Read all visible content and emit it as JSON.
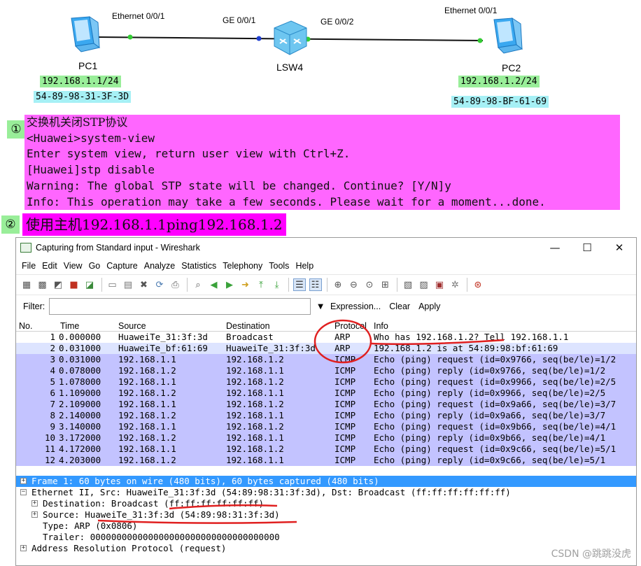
{
  "topology": {
    "pc1": {
      "name": "PC1",
      "port": "Ethernet 0/0/1",
      "ip": "192.168.1.1/24",
      "mac": "54-89-98-31-3F-3D"
    },
    "switch": {
      "name": "LSW4",
      "port_left": "GE 0/0/1",
      "port_right": "GE 0/0/2"
    },
    "pc2": {
      "name": "PC2",
      "port": "Ethernet 0/0/1",
      "ip": "192.168.1.2/24",
      "mac": "54-89-98-BF-61-69"
    }
  },
  "step1": {
    "number": "①",
    "lines": [
      "交换机关闭STP协议",
      "<Huawei>system-view",
      "Enter system view, return user view with Ctrl+Z.",
      "[Huawei]stp disable",
      "Warning: The global STP state will be changed. Continue? [Y/N]y",
      "Info: This operation may take a few seconds. Please wait for a moment...done."
    ]
  },
  "step2": {
    "number": "②",
    "text": "使用主机192.168.1.1ping192.168.1.2"
  },
  "wireshark": {
    "title": "Capturing from Standard input - Wireshark",
    "window_controls": [
      "—",
      "☐",
      "✕"
    ],
    "menu": [
      "File",
      "Edit",
      "View",
      "Go",
      "Capture",
      "Analyze",
      "Statistics",
      "Telephony",
      "Tools",
      "Help"
    ],
    "filter": {
      "label": "Filter:",
      "value": "",
      "expression": "Expression...",
      "clear": "Clear",
      "apply": "Apply"
    },
    "columns": {
      "no": "No.",
      "time": "Time",
      "source": "Source",
      "destination": "Destination",
      "protocol": "Protocol",
      "info": "Info"
    },
    "packets": [
      {
        "no": "1",
        "time": "0.000000",
        "source": "HuaweiTe_31:3f:3d",
        "destination": "Broadcast",
        "protocol": "ARP",
        "info": "Who has 192.168.1.2?  Tell 192.168.1.1",
        "bg": "#ffffff"
      },
      {
        "no": "2",
        "time": "0.031000",
        "source": "HuaweiTe_bf:61:69",
        "destination": "HuaweiTe_31:3f:3d",
        "protocol": "ARP",
        "info": "192.168.1.2 is at 54:89:98:bf:61:69",
        "bg": "#dde4ff"
      },
      {
        "no": "3",
        "time": "0.031000",
        "source": "192.168.1.1",
        "destination": "192.168.1.2",
        "protocol": "ICMP",
        "info": "Echo (ping) request  (id=0x9766, seq(be/le)=1/2",
        "bg": "#c3c3ff"
      },
      {
        "no": "4",
        "time": "0.078000",
        "source": "192.168.1.2",
        "destination": "192.168.1.1",
        "protocol": "ICMP",
        "info": "Echo (ping) reply    (id=0x9766, seq(be/le)=1/2",
        "bg": "#c3c3ff"
      },
      {
        "no": "5",
        "time": "1.078000",
        "source": "192.168.1.1",
        "destination": "192.168.1.2",
        "protocol": "ICMP",
        "info": "Echo (ping) request  (id=0x9966, seq(be/le)=2/5",
        "bg": "#c3c3ff"
      },
      {
        "no": "6",
        "time": "1.109000",
        "source": "192.168.1.2",
        "destination": "192.168.1.1",
        "protocol": "ICMP",
        "info": "Echo (ping) reply    (id=0x9966, seq(be/le)=2/5",
        "bg": "#c3c3ff"
      },
      {
        "no": "7",
        "time": "2.109000",
        "source": "192.168.1.1",
        "destination": "192.168.1.2",
        "protocol": "ICMP",
        "info": "Echo (ping) request  (id=0x9a66, seq(be/le)=3/7",
        "bg": "#c3c3ff"
      },
      {
        "no": "8",
        "time": "2.140000",
        "source": "192.168.1.2",
        "destination": "192.168.1.1",
        "protocol": "ICMP",
        "info": "Echo (ping) reply    (id=0x9a66, seq(be/le)=3/7",
        "bg": "#c3c3ff"
      },
      {
        "no": "9",
        "time": "3.140000",
        "source": "192.168.1.1",
        "destination": "192.168.1.2",
        "protocol": "ICMP",
        "info": "Echo (ping) request  (id=0x9b66, seq(be/le)=4/1",
        "bg": "#c3c3ff"
      },
      {
        "no": "10",
        "time": "3.172000",
        "source": "192.168.1.2",
        "destination": "192.168.1.1",
        "protocol": "ICMP",
        "info": "Echo (ping) reply    (id=0x9b66, seq(be/le)=4/1",
        "bg": "#c3c3ff"
      },
      {
        "no": "11",
        "time": "4.172000",
        "source": "192.168.1.1",
        "destination": "192.168.1.2",
        "protocol": "ICMP",
        "info": "Echo (ping) request  (id=0x9c66, seq(be/le)=5/1",
        "bg": "#c3c3ff"
      },
      {
        "no": "12",
        "time": "4.203000",
        "source": "192.168.1.2",
        "destination": "192.168.1.1",
        "protocol": "ICMP",
        "info": "Echo (ping) reply    (id=0x9c66, seq(be/le)=5/1",
        "bg": "#c3c3ff"
      }
    ],
    "details": {
      "frame": "Frame 1: 60 bytes on wire (480 bits), 60 bytes captured (480 bits)",
      "ethernet": "Ethernet II, Src: HuaweiTe_31:3f:3d (54:89:98:31:3f:3d), Dst: Broadcast (ff:ff:ff:ff:ff:ff)",
      "destination": "Destination: Broadcast (ff:ff:ff:ff:ff:ff)",
      "source": "Source: HuaweiTe_31:3f:3d (54:89:98:31:3f:3d)",
      "type": "Type: ARP (0x0806)",
      "trailer": "Trailer: 000000000000000000000000000000000000",
      "arp": "Address Resolution Protocol (request)"
    }
  },
  "watermark": "CSDN @跳跳没虎",
  "colors": {
    "annotation_red": "#e02020",
    "selected_row": "#3399ff",
    "icmp_row": "#c3c3ff"
  }
}
